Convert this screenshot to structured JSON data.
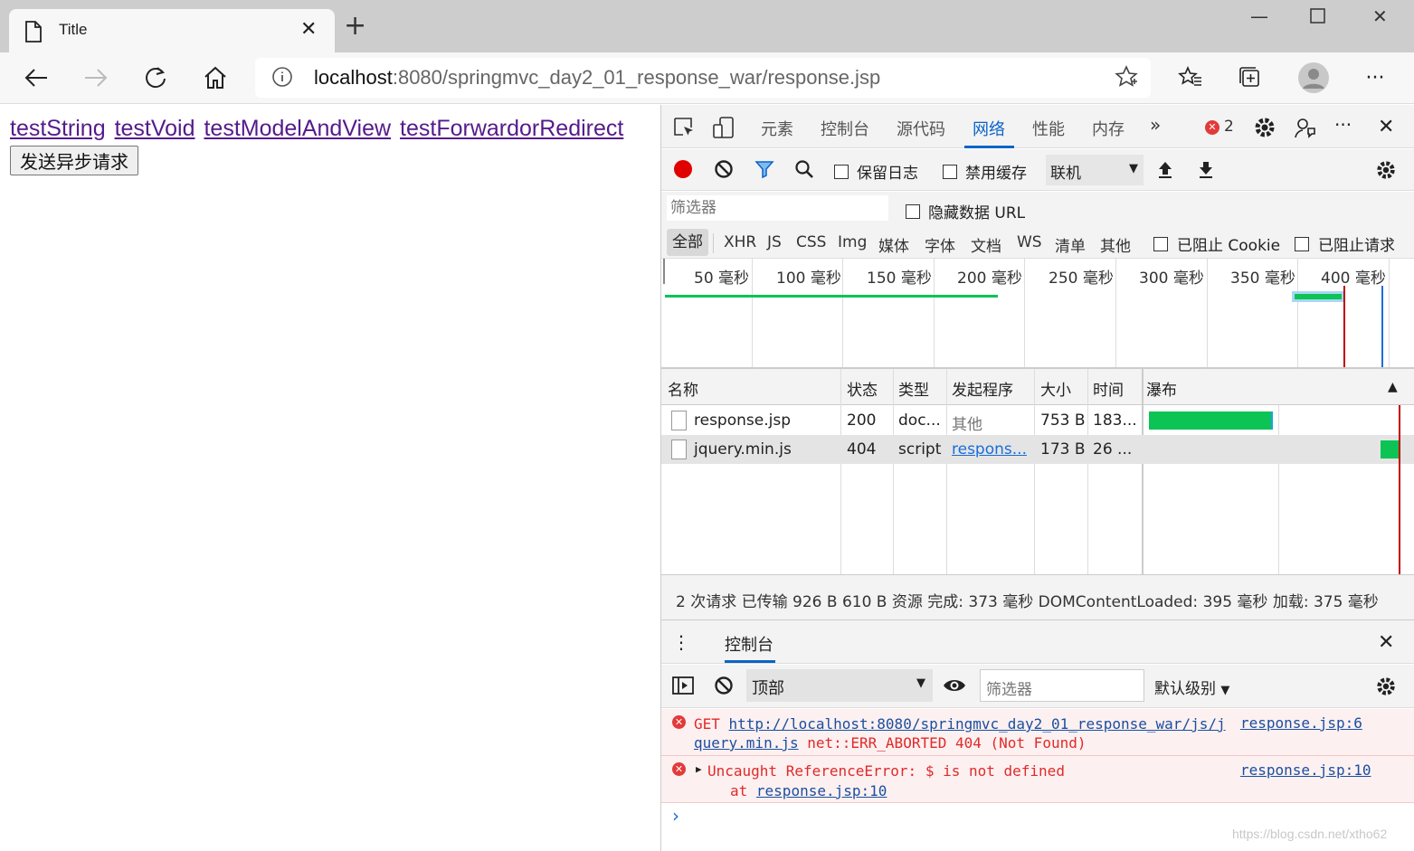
{
  "browser": {
    "tab_title": "Title",
    "url_host": "localhost",
    "url_rest": ":8080/springmvc_day2_01_response_war/response.jsp"
  },
  "page": {
    "links": [
      "testString",
      "testVoid",
      "testModelAndView",
      "testForwardorRedirect"
    ],
    "ajax_button": "发送异步请求"
  },
  "devtools": {
    "tabs": [
      "元素",
      "控制台",
      "源代码",
      "网络",
      "性能",
      "内存"
    ],
    "selected_tab": "网络",
    "more": "»",
    "error_count": "2",
    "net_toolbar": {
      "preserve_log": "保留日志",
      "disable_cache": "禁用缓存",
      "throttle": "联机"
    },
    "filter_placeholder": "筛选器",
    "hide_data_url": "隐藏数据 URL",
    "types": [
      "全部",
      "XHR",
      "JS",
      "CSS",
      "Img",
      "媒体",
      "字体",
      "文档",
      "WS",
      "清单",
      "其他"
    ],
    "blocked_cookie": "已阻止 Cookie",
    "blocked_requests": "已阻止请求",
    "overview_ticks": [
      "50 毫秒",
      "100 毫秒",
      "150 毫秒",
      "200 毫秒",
      "250 毫秒",
      "300 毫秒",
      "350 毫秒",
      "400 毫秒"
    ],
    "columns": [
      "名称",
      "状态",
      "类型",
      "发起程序",
      "大小",
      "时间",
      "瀑布"
    ],
    "rows": [
      {
        "name": "response.jsp",
        "status": "200",
        "type": "doc...",
        "initiator": "其他",
        "size": "753 B",
        "time": "183..."
      },
      {
        "name": "jquery.min.js",
        "status": "404",
        "type": "script",
        "initiator": "respons...",
        "size": "173 B",
        "time": "26 ..."
      }
    ],
    "summary": "2 次请求  已传输 926 B  610 B 资源  完成: 373 毫秒  DOMContentLoaded: 395 毫秒  加载: 375 毫秒",
    "drawer_tab": "控制台",
    "console": {
      "context": "顶部",
      "filter_placeholder": "筛选器",
      "level": "默认级别",
      "messages": [
        {
          "prefix": "GET ",
          "link1": "http://localhost:8080/springmvc_day2_01_response_war/js/j",
          "link2": "query.min.js",
          "rest": " net::ERR_ABORTED 404 (Not Found)",
          "source": "response.jsp:6"
        },
        {
          "text": "Uncaught ReferenceError: $ is not defined",
          "at": "at ",
          "at_link": "response.jsp:10",
          "source": "response.jsp:10"
        }
      ],
      "prompt": "›"
    }
  },
  "watermark": "https://blog.csdn.net/xtho62",
  "colors": {
    "accent": "#0a64c8",
    "error": "#e23a3a",
    "waterfall_green": "#0bc454",
    "visited_link": "#551a8b"
  }
}
